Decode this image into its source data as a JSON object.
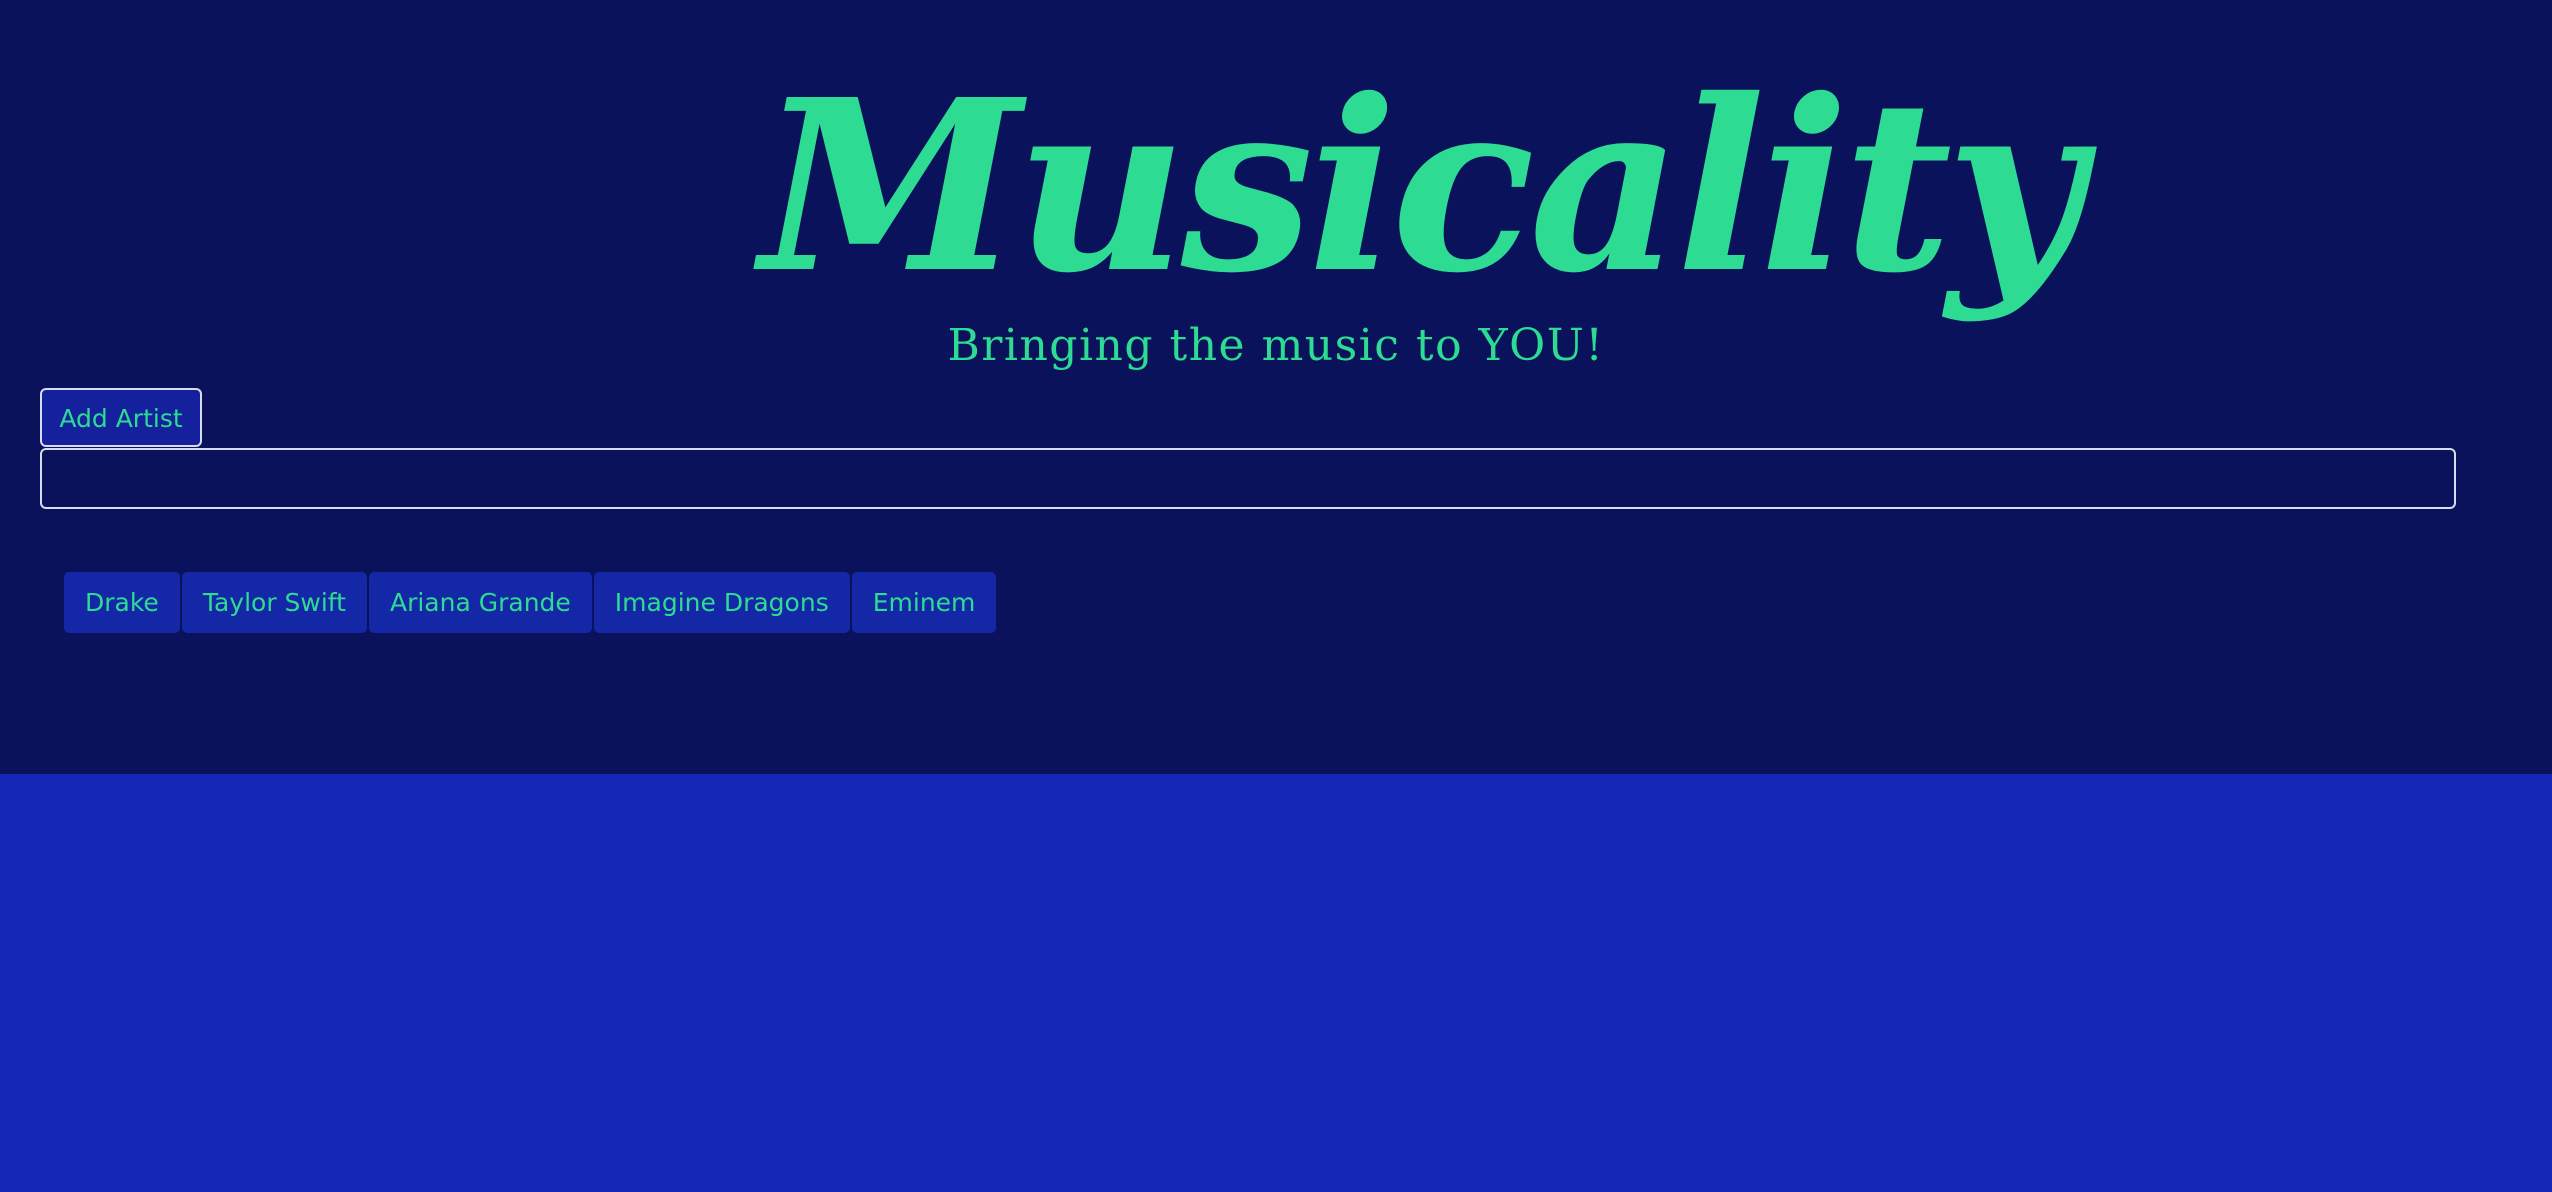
{
  "brand": {
    "logo_text": "Musicality",
    "tagline": "Bringing the music to YOU!"
  },
  "controls": {
    "add_artist_label": "Add Artist",
    "artist_input_value": "",
    "artist_input_placeholder": ""
  },
  "artists": [
    "Drake",
    "Taylor Swift",
    "Ariana Grande",
    "Imagine Dragons",
    "Eminem"
  ],
  "colors": {
    "header_background": "#09125b",
    "page_background": "#1426b5",
    "accent": "#2ddc92",
    "chip_background": "#1427a6",
    "border": "#d8dcef"
  }
}
